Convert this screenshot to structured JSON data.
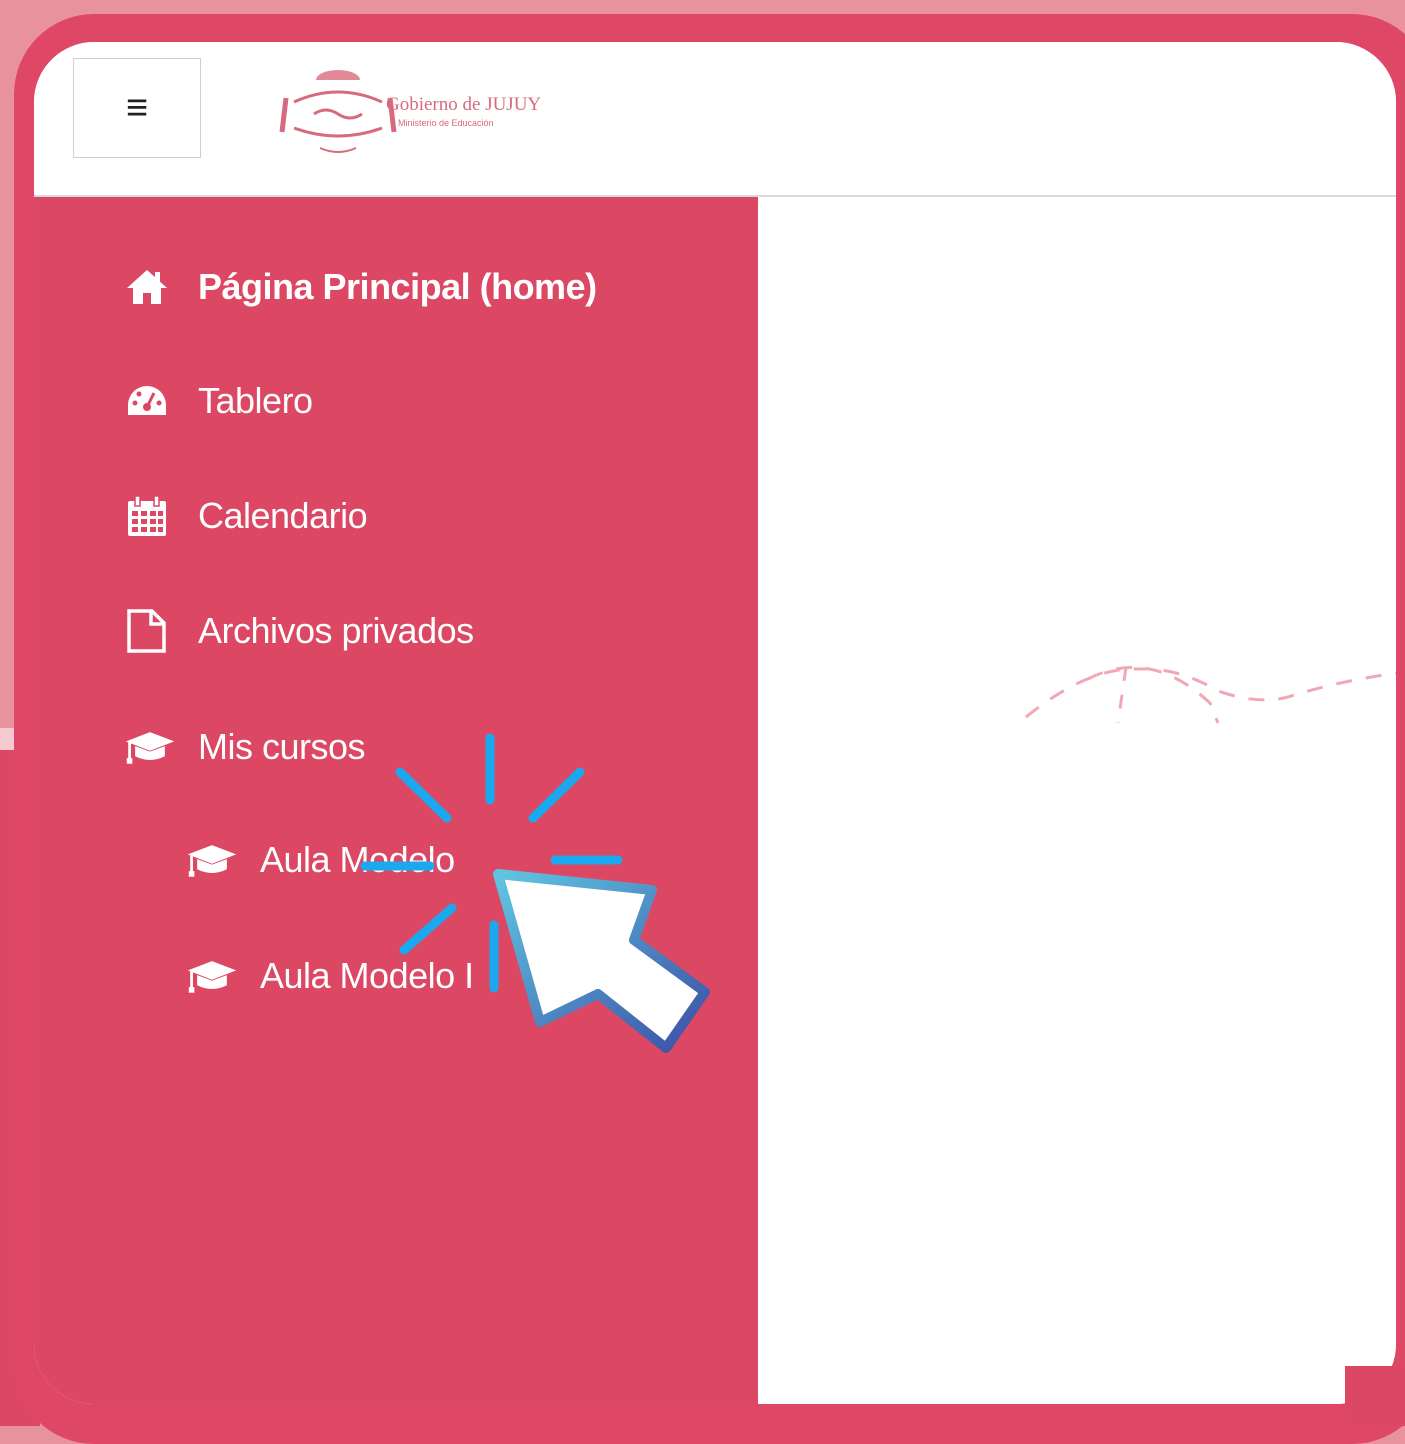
{
  "logo": {
    "title": "Gobierno de JUJUY",
    "subtitle": "Ministerio de Educación"
  },
  "topbar": {
    "menu_icon": "hamburger-icon"
  },
  "sidebar": {
    "items": [
      {
        "label": "Página Principal (home)",
        "icon": "home-icon"
      },
      {
        "label": "Tablero",
        "icon": "dashboard-icon"
      },
      {
        "label": "Calendario",
        "icon": "calendar-icon"
      },
      {
        "label": "Archivos privados",
        "icon": "file-icon"
      },
      {
        "label": "Mis cursos",
        "icon": "graduation-cap-icon"
      }
    ],
    "courses": [
      {
        "label": "Aula Modelo",
        "icon": "graduation-cap-icon"
      },
      {
        "label": "Aula Modelo I",
        "icon": "graduation-cap-icon"
      }
    ]
  },
  "colors": {
    "sidebar": "#dc4764",
    "frame": "#e8929f",
    "cursor_gradient_start": "#5fc6e0",
    "cursor_gradient_end": "#3d4fa6",
    "click_burst": "#1aa9ee"
  }
}
